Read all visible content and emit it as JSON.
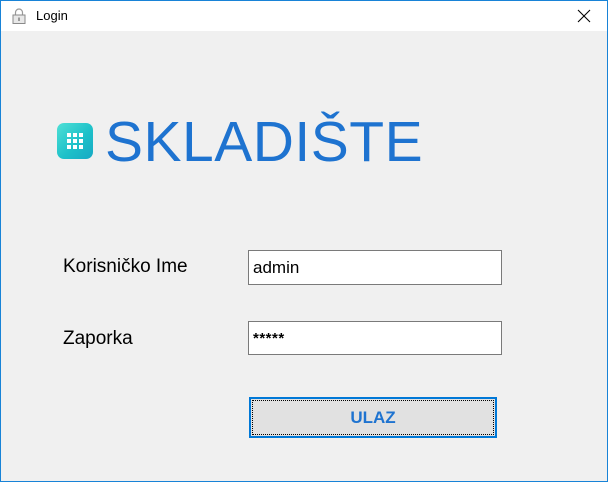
{
  "window": {
    "title": "Login",
    "title_icon": "lock-icon",
    "close_icon": "close-icon"
  },
  "header": {
    "app_title": "SKLADIŠTE",
    "logo_icon": "grid-app-icon",
    "title_color": "#1e73d0",
    "logo_color": "#1ec1c9"
  },
  "form": {
    "username_label": "Korisničko Ime",
    "username_value": "admin",
    "password_label": "Zaporka",
    "password_value": "*****",
    "login_button_label": "ULAZ"
  },
  "colors": {
    "accent": "#0078d7",
    "background": "#f0f0f0"
  }
}
